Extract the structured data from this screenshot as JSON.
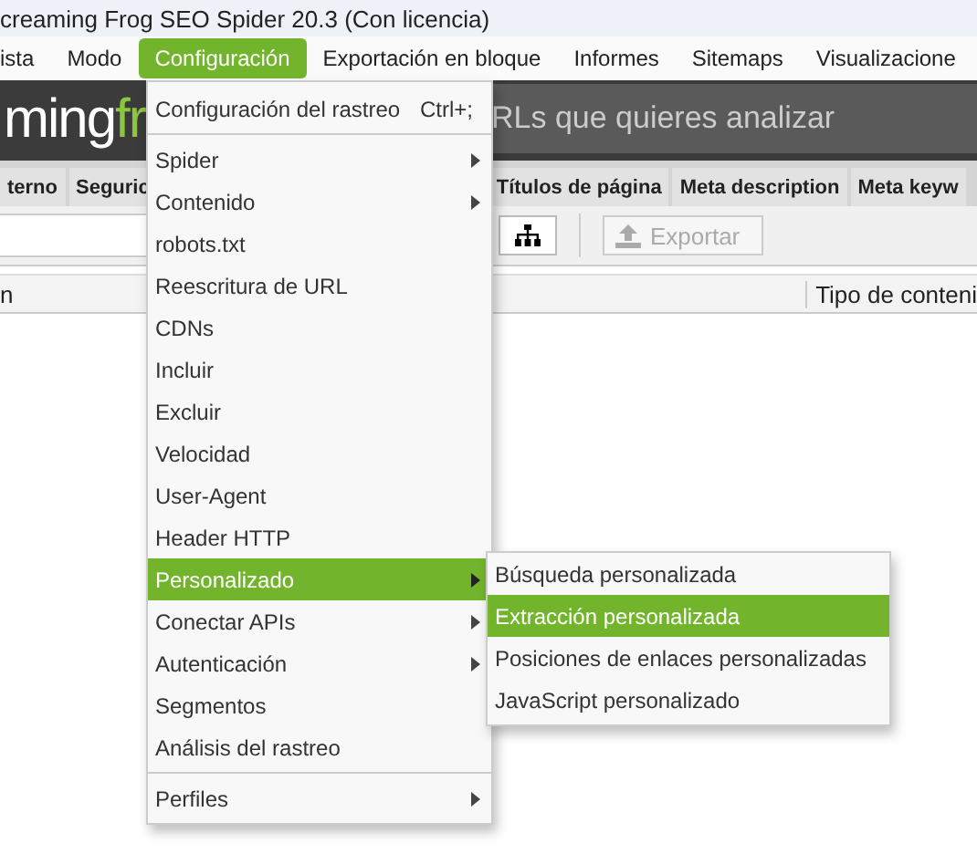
{
  "window": {
    "title": "creaming Frog SEO Spider 20.3 (Con licencia)"
  },
  "menubar": [
    {
      "label": "ista",
      "selected": false
    },
    {
      "label": "Modo",
      "selected": false
    },
    {
      "label": "Configuración",
      "selected": true
    },
    {
      "label": "Exportación en bloque",
      "selected": false
    },
    {
      "label": "Informes",
      "selected": false
    },
    {
      "label": "Sitemaps",
      "selected": false
    },
    {
      "label": "Visualizacione",
      "selected": false
    }
  ],
  "logo": {
    "text": "ming",
    "accent": "fr"
  },
  "url_field": {
    "placeholder": "RLs que quieres analizar"
  },
  "tabs": [
    {
      "label": "terno",
      "selected": false
    },
    {
      "label": "Seguric",
      "selected": false
    },
    {
      "label": "Títulos de página",
      "selected": false
    },
    {
      "label": "Meta description",
      "selected": false
    },
    {
      "label": "Meta keyw",
      "selected": false
    }
  ],
  "toolbar": {
    "export_button": {
      "label": "Exportar",
      "disabled": true
    }
  },
  "table": {
    "columns": [
      "n",
      "Tipo de conteni"
    ]
  },
  "menu": {
    "sections": [
      [
        {
          "label": "Configuración del rastreo",
          "shortcut": "Ctrl+;",
          "submenu": false,
          "selected": false
        }
      ],
      [
        {
          "label": "Spider",
          "submenu": true,
          "selected": false
        },
        {
          "label": "Contenido",
          "submenu": true,
          "selected": false
        },
        {
          "label": "robots.txt",
          "submenu": false,
          "selected": false
        },
        {
          "label": "Reescritura de URL",
          "submenu": false,
          "selected": false
        },
        {
          "label": "CDNs",
          "submenu": false,
          "selected": false
        },
        {
          "label": "Incluir",
          "submenu": false,
          "selected": false
        },
        {
          "label": "Excluir",
          "submenu": false,
          "selected": false
        },
        {
          "label": "Velocidad",
          "submenu": false,
          "selected": false
        },
        {
          "label": "User-Agent",
          "submenu": false,
          "selected": false
        },
        {
          "label": "Header HTTP",
          "submenu": false,
          "selected": false
        },
        {
          "label": "Personalizado",
          "submenu": true,
          "selected": true
        },
        {
          "label": "Conectar APIs",
          "submenu": true,
          "selected": false
        },
        {
          "label": "Autenticación",
          "submenu": true,
          "selected": false
        },
        {
          "label": "Segmentos",
          "submenu": false,
          "selected": false
        },
        {
          "label": "Análisis del rastreo",
          "submenu": false,
          "selected": false
        }
      ],
      [
        {
          "label": "Perfiles",
          "submenu": true,
          "selected": false
        }
      ]
    ]
  },
  "submenu": [
    {
      "label": "Búsqueda personalizada",
      "selected": false
    },
    {
      "label": "Extracción personalizada",
      "selected": true
    },
    {
      "label": "Posiciones de enlaces personalizadas",
      "selected": false
    },
    {
      "label": "JavaScript personalizado",
      "selected": false
    }
  ]
}
